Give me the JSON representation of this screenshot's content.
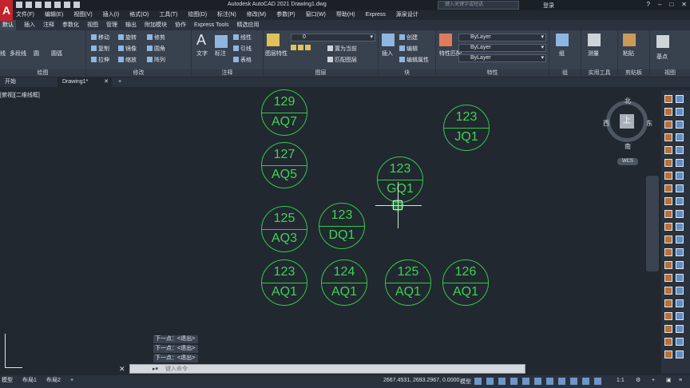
{
  "app": {
    "title": "Autodesk AutoCAD 2021   Drawing1.dwg",
    "search_placeholder": "键入关键字或短语",
    "login": "登录"
  },
  "menu": [
    "文件(F)",
    "编辑(E)",
    "视图(V)",
    "插入(I)",
    "格式(O)",
    "工具(T)",
    "绘图(D)",
    "标注(N)",
    "修改(M)",
    "参数(P)",
    "窗口(W)",
    "帮助(H)",
    "Express",
    "源泉设计"
  ],
  "ribbon_tabs": [
    "默认",
    "插入",
    "注释",
    "参数化",
    "视图",
    "管理",
    "输出",
    "附加模块",
    "协作",
    "Express Tools",
    "精选应用"
  ],
  "ribbon": {
    "draw": {
      "title": "绘图",
      "line": "线",
      "polyline": "多段线",
      "circle": "圆",
      "arc": "圆弧"
    },
    "modify": {
      "title": "修改",
      "move": "移动",
      "rotate": "旋转",
      "trim": "修剪",
      "copy": "复制",
      "mirror": "镜像",
      "fillet": "圆角",
      "stretch": "拉伸",
      "scale": "缩放",
      "array": "阵列"
    },
    "annotation": {
      "title": "注释",
      "text": "文字",
      "dimension": "标注",
      "linear": "线性",
      "leader": "引线",
      "table": "表格"
    },
    "layers": {
      "title": "图层",
      "layer_props": "图层特性",
      "layer_value": "0",
      "set_current": "置为当前",
      "match": "匹配图层"
    },
    "block": {
      "title": "块",
      "insert": "插入",
      "create": "创建",
      "edit": "编辑",
      "edit_attr": "编辑属性"
    },
    "properties": {
      "title": "特性",
      "match_props": "特性匹配",
      "color": "ByLayer",
      "linetype": "ByLayer",
      "lineweight": "ByLayer"
    },
    "groups": {
      "title": "组",
      "group": "组"
    },
    "utilities": {
      "title": "实用工具",
      "measure": "测量"
    },
    "clipboard": {
      "title": "剪贴板",
      "paste": "粘贴"
    },
    "view": {
      "title": "视图",
      "base": "基点"
    }
  },
  "file_tabs": {
    "start": "开始",
    "drawing": "Drawing1*",
    "add": "+"
  },
  "viewport_label": "[俯视][二维线框]",
  "bubbles": [
    {
      "num": "129",
      "code": "AQ7"
    },
    {
      "num": "123",
      "code": "JQ1"
    },
    {
      "num": "127",
      "code": "AQ5"
    },
    {
      "num": "123",
      "code": "GQ1"
    },
    {
      "num": "125",
      "code": "AQ3"
    },
    {
      "num": "123",
      "code": "DQ1"
    },
    {
      "num": "123",
      "code": "AQ1"
    },
    {
      "num": "124",
      "code": "AQ1"
    },
    {
      "num": "125",
      "code": "AQ1"
    },
    {
      "num": "126",
      "code": "AQ1"
    }
  ],
  "viewcube": {
    "north": "北",
    "south": "南",
    "west": "西",
    "east": "东",
    "top": "上",
    "wcs": "WCS"
  },
  "command": {
    "history": [
      "下一点：<退出>",
      "下一点：<退出>",
      "下一点：<退出>"
    ],
    "placeholder": "键入命令"
  },
  "status": {
    "model_tab": "模型",
    "layout1": "布局1",
    "layout2": "布局2",
    "coords": "2667.4531, 2693.2967, 0.0000",
    "mode": "模型",
    "scale": "1:1"
  },
  "colors": {
    "bubble": "#34c94a",
    "background": "#212830",
    "ribbon": "#38414e"
  }
}
